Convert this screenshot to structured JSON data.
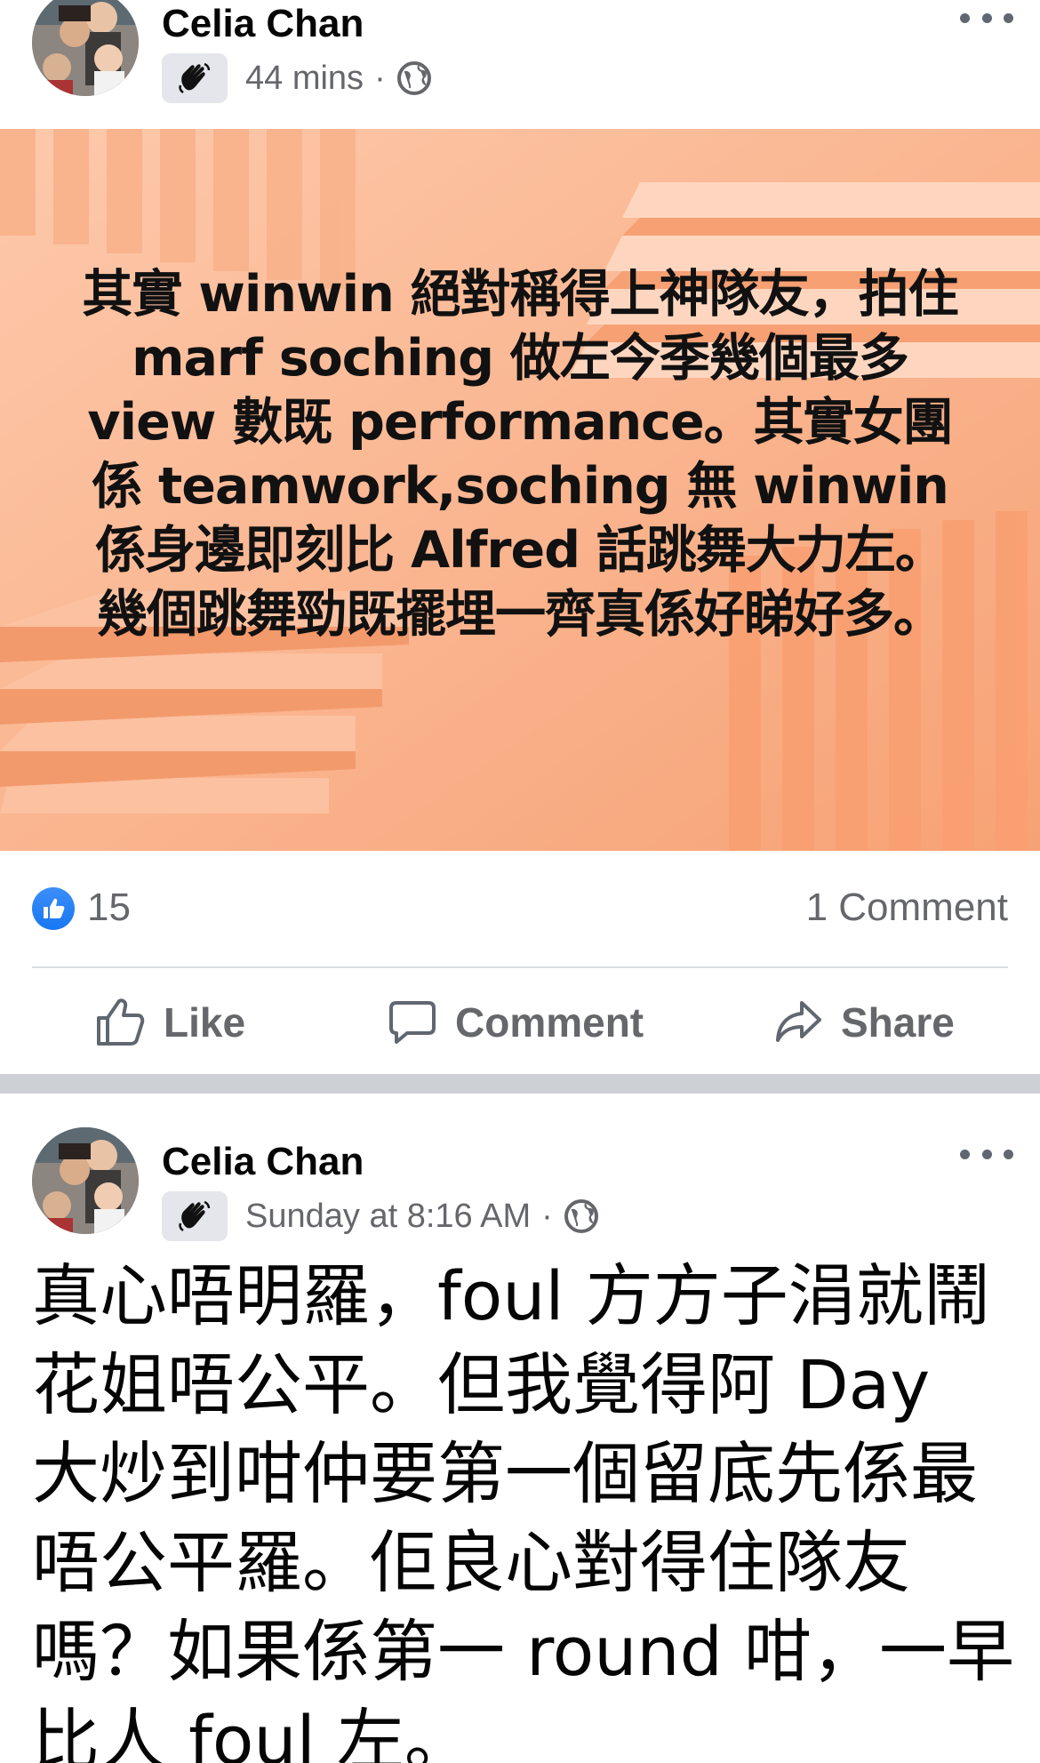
{
  "posts": [
    {
      "author": "Celia Chan",
      "time": "44 mins",
      "privacy_icon": "globe-icon",
      "badge_icon": "wave-icon",
      "text": "其實 winwin 絕對稱得上神隊友，拍住 marf soching 做左今季幾個最多 view 數既 performance。其實女團係 teamwork,soching 無 winwin 係身邊即刻比 Alfred 話跳舞大力左。幾個跳舞勁既擺埋一齊真係好睇好多。",
      "background": "peach-staircase",
      "reactions_count": "15",
      "comments_count": "1 Comment",
      "actions": {
        "like": "Like",
        "comment": "Comment",
        "share": "Share"
      }
    },
    {
      "author": "Celia Chan",
      "time": "Sunday at 8:16 AM",
      "privacy_icon": "globe-icon",
      "badge_icon": "wave-icon",
      "text": "真心唔明羅，foul 方方子涓就鬧花姐唔公平。但我覺得阿 Day 大炒到咁仲要第一個留底先係最唔公平羅。佢良心對得住隊友嗎？如果係第一 round 咁，一早比人 foul 左。"
    }
  ],
  "colors": {
    "accent": "#1877f2",
    "secondary_text": "#65676b",
    "divider": "#cdd0d5",
    "card_bg": "#fbb58f"
  }
}
